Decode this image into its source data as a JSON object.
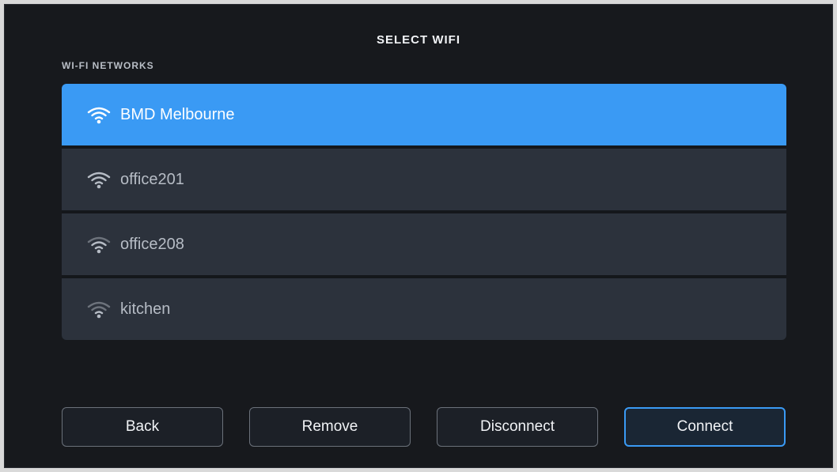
{
  "dialog": {
    "title": "SELECT WIFI",
    "section_label": "WI-FI NETWORKS"
  },
  "networks": [
    {
      "name": "BMD Melbourne",
      "selected": true,
      "signal_icon": "wifi-icon",
      "signal_strength": 1.0
    },
    {
      "name": "office201",
      "selected": false,
      "signal_icon": "wifi-icon",
      "signal_strength": 0.8
    },
    {
      "name": "office208",
      "selected": false,
      "signal_icon": "wifi-icon",
      "signal_strength": 0.6
    },
    {
      "name": "kitchen",
      "selected": false,
      "signal_icon": "wifi-icon",
      "signal_strength": 0.5
    }
  ],
  "buttons": {
    "back": "Back",
    "remove": "Remove",
    "disconnect": "Disconnect",
    "connect": "Connect"
  },
  "colors": {
    "accent": "#3a9af4",
    "background": "#17191d",
    "list_item": "#2c323c"
  }
}
